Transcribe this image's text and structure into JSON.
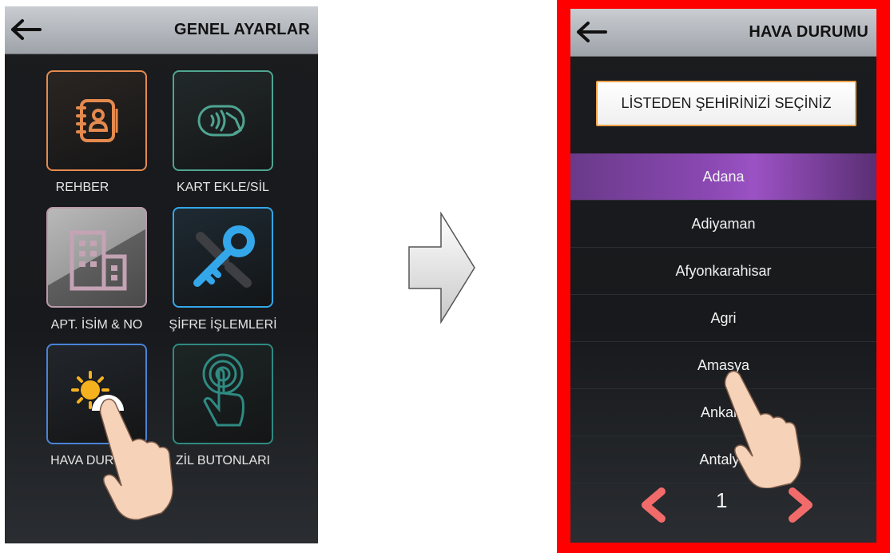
{
  "left": {
    "title": "GENEL AYARLAR",
    "tiles": [
      {
        "label": "REHBER",
        "icon": "address-book-icon",
        "color": "#e58a4e"
      },
      {
        "label": "KART EKLE/SİL",
        "icon": "contactless-card-icon",
        "color": "#4fa591"
      },
      {
        "label": "APT. İSİM & NO",
        "icon": "building-icon",
        "color": "#b99aa9"
      },
      {
        "label": "ŞİFRE İŞLEMLERİ",
        "icon": "key-wrench-icon",
        "color": "#33a7ea"
      },
      {
        "label": "HAVA DURUMU",
        "icon": "weather-sun-cloud-icon",
        "color": "#4a83d7"
      },
      {
        "label": "ZİL BUTONLARI",
        "icon": "touch-button-icon",
        "color": "#2f8a82"
      }
    ]
  },
  "right": {
    "title": "HAVA DURUMU",
    "select_button": "LİSTEDEN ŞEHİRİNİZİ SEÇİNİZ",
    "cities": [
      "Adana",
      "Adiyaman",
      "Afyonkarahisar",
      "Agri",
      "Amasya",
      "Ankara",
      "Antalya"
    ],
    "selected_city": "Adana",
    "page": "1",
    "frame_color": "#ff0000",
    "accent_color": "#f26b6b"
  }
}
